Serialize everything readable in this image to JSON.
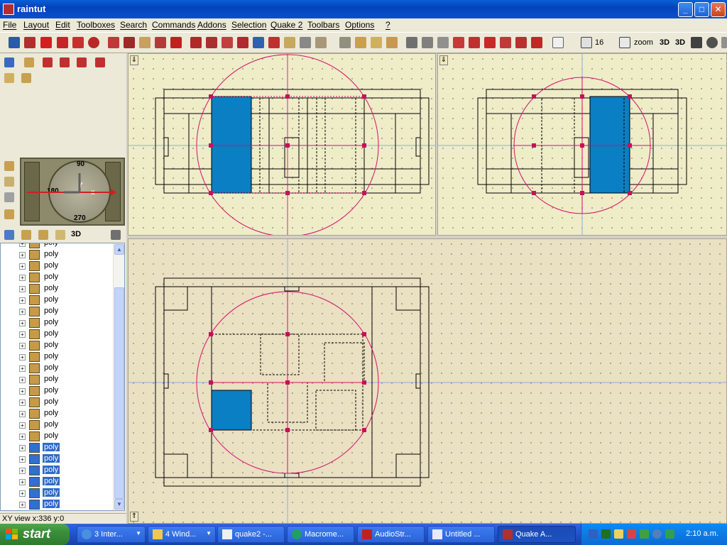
{
  "window": {
    "title": "raintut",
    "minimize": "_",
    "maximize": "□",
    "close": "✕"
  },
  "menu": [
    "File",
    "Layout",
    "Edit",
    "Toolboxes",
    "Search",
    "Commands",
    "Addons",
    "Selection",
    "Quake 2",
    "Toolbars",
    "Options",
    "?"
  ],
  "toolbar": {
    "grid_value": "16",
    "zoom_label": "zoom",
    "buttons_3d": [
      "3D",
      "3D"
    ]
  },
  "compass": {
    "top": "90",
    "left": "180",
    "bottom": "270",
    "axis_y": "Y",
    "axis_x": "x"
  },
  "tree_label": "3D",
  "tree": {
    "items": [
      {
        "name": "poly",
        "selected": false
      },
      {
        "name": "poly",
        "selected": false
      },
      {
        "name": "poly",
        "selected": false
      },
      {
        "name": "poly",
        "selected": false
      },
      {
        "name": "poly",
        "selected": false
      },
      {
        "name": "poly",
        "selected": false
      },
      {
        "name": "poly",
        "selected": false
      },
      {
        "name": "poly",
        "selected": false
      },
      {
        "name": "poly",
        "selected": false
      },
      {
        "name": "poly",
        "selected": false
      },
      {
        "name": "poly",
        "selected": false
      },
      {
        "name": "poly",
        "selected": false
      },
      {
        "name": "poly",
        "selected": false
      },
      {
        "name": "poly",
        "selected": false
      },
      {
        "name": "poly",
        "selected": false
      },
      {
        "name": "poly",
        "selected": false
      },
      {
        "name": "poly",
        "selected": false
      },
      {
        "name": "poly",
        "selected": false
      },
      {
        "name": "poly",
        "selected": true
      },
      {
        "name": "poly",
        "selected": true
      },
      {
        "name": "poly",
        "selected": true
      },
      {
        "name": "poly",
        "selected": true
      },
      {
        "name": "poly",
        "selected": true
      },
      {
        "name": "poly",
        "selected": true
      }
    ]
  },
  "status": {
    "left_text": "XY view x:336 y:0"
  },
  "taskbar": {
    "start_label": "start",
    "tasks": [
      "3 Inter...",
      "4 Wind...",
      "quake2 -...",
      "Macrome...",
      "AudioStr...",
      "Untitled ...",
      "Quake A..."
    ],
    "clock": "2:10 a.m."
  },
  "colors": {
    "selection_fill": "#0a7fc4",
    "handle": "#c8105a",
    "circle": "#d4106a",
    "tree_select": "#316ac5"
  }
}
